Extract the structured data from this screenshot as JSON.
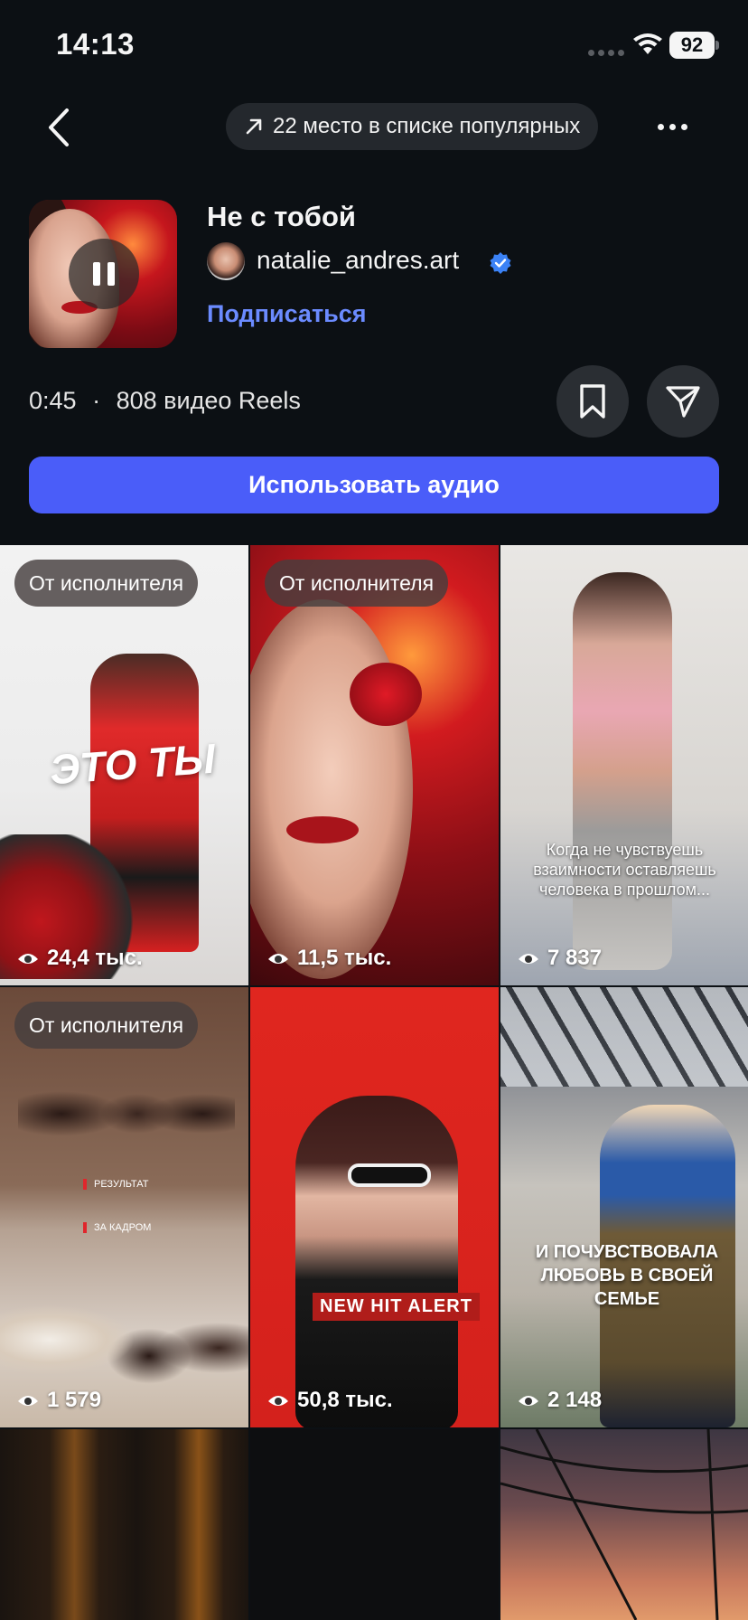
{
  "status_bar": {
    "time": "14:13",
    "battery": "92"
  },
  "header": {
    "chart_label": "22 место в списке популярных"
  },
  "song": {
    "title": "Не с тобой",
    "artist": "natalie_andres.art",
    "follow_label": "Подписаться",
    "duration": "0:45",
    "separator": "·",
    "reels_count": "808 видео Reels"
  },
  "use_audio_label": "Использовать аудио",
  "colors": {
    "accent": "#4a5df9",
    "link": "#6b8bff",
    "verified": "#3b82f6",
    "background": "#0c1014"
  },
  "reels": [
    {
      "badge": "От исполнителя",
      "views": "24,4 тыс.",
      "overlay": "ЭТО ТЫ"
    },
    {
      "badge": "От исполнителя",
      "views": "11,5 тыс."
    },
    {
      "views": "7 837",
      "caption": "Когда не чувствуешь взаимности оставляешь человека в прошлом..."
    },
    {
      "badge": "От исполнителя",
      "views": "1 579",
      "label_top": "РЕЗУЛЬТАТ",
      "label_bottom": "ЗА КАДРОМ"
    },
    {
      "views": "50,8 тыс.",
      "overlay": "NEW HIT ALERT"
    },
    {
      "views": "2 148",
      "overlay": "И ПОЧУВСТВОВАЛА ЛЮБОВЬ В СВОЕЙ СЕМЬЕ"
    },
    {},
    {},
    {}
  ]
}
